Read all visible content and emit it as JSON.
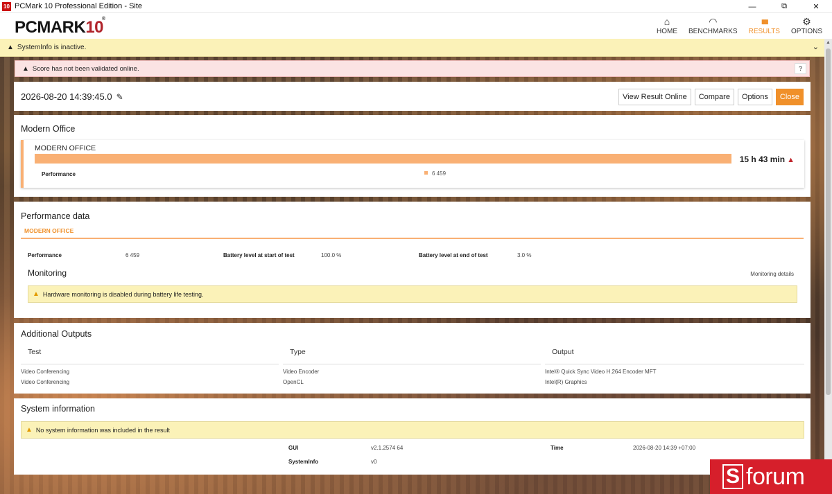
{
  "window": {
    "icon": "10",
    "title": "PCMark 10 Professional Edition - Site",
    "minimize": "—",
    "restore": "⧉",
    "close": "✕"
  },
  "header": {
    "logo_main": "PCMARK",
    "logo_num": "10",
    "logo_reg": "®",
    "nav": [
      {
        "label": "HOME",
        "icon": "home-icon",
        "glyph": "⌂"
      },
      {
        "label": "BENCHMARKS",
        "icon": "speedometer-icon",
        "glyph": "◠"
      },
      {
        "label": "RESULTS",
        "icon": "bar-chart-icon",
        "glyph": "▮▮▮"
      },
      {
        "label": "OPTIONS",
        "icon": "gear-icon",
        "glyph": "⚙"
      }
    ],
    "active": "RESULTS",
    "accent": "#f0902a"
  },
  "sysinfo_bar": {
    "text": "SystemInfo is inactive."
  },
  "validation_warning": {
    "text": "Score has not been validated online.",
    "help": "?"
  },
  "result": {
    "date": "2026-08-20 14:39:45.0",
    "buttons": {
      "view_online": "View Result Online",
      "compare": "Compare",
      "options": "Options",
      "close": "Close"
    }
  },
  "modern_office": {
    "section_title": "Modern Office",
    "card_title": "MODERN OFFICE",
    "time": "15 h 43 min",
    "perf_label": "Performance",
    "perf_value": "6 459"
  },
  "performance_data": {
    "title": "Performance data",
    "tab": "MODERN OFFICE",
    "metrics": [
      {
        "label": "Performance",
        "value": "6 459"
      },
      {
        "label": "Battery level at start of test",
        "value": "100.0 %"
      },
      {
        "label": "Battery level at end of test",
        "value": "3.0 %"
      }
    ],
    "monitoring_title": "Monitoring",
    "monitoring_details": "Monitoring details",
    "monitoring_warning": "Hardware monitoring is disabled during battery life testing."
  },
  "additional_outputs": {
    "title": "Additional Outputs",
    "columns": [
      "Test",
      "Type",
      "Output"
    ],
    "rows": [
      [
        "Video Conferencing",
        "Video Encoder",
        "Intel® Quick Sync Video H.264 Encoder MFT"
      ],
      [
        "Video Conferencing",
        "OpenCL",
        "Intel(R) Graphics"
      ]
    ]
  },
  "system_information": {
    "title": "System information",
    "warning": "No system information was included in the result",
    "fields": [
      {
        "label": "GUI",
        "value": "v2.1.2574 64"
      },
      {
        "label": "Time",
        "value": "2026-08-20 14:39 +07:00"
      },
      {
        "label": "SystemInfo",
        "value": "v0"
      }
    ]
  },
  "watermark": {
    "letter": "S",
    "text": "forum"
  }
}
